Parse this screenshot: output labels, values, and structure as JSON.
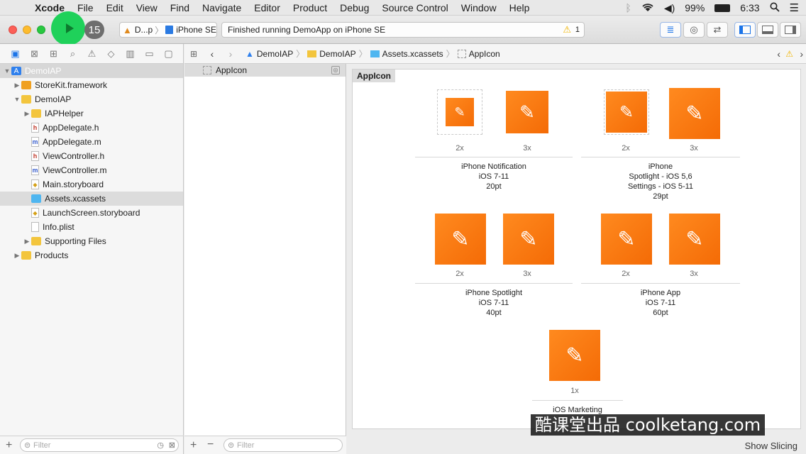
{
  "menubar": {
    "app_name": "Xcode",
    "items": [
      "File",
      "Edit",
      "View",
      "Find",
      "Navigate",
      "Editor",
      "Product",
      "Debug",
      "Source Control",
      "Window",
      "Help"
    ],
    "battery": "99%",
    "time": "6:33"
  },
  "toolbar": {
    "issue_count": "15",
    "scheme": "D...p",
    "device": "iPhone SE",
    "status": "Finished running DemoApp on iPhone SE",
    "warning_count": "1"
  },
  "navigator": {
    "tree": [
      {
        "label": "DemoIAP",
        "indent": 0,
        "icon": "project",
        "tri": "▼"
      },
      {
        "label": "StoreKit.framework",
        "indent": 1,
        "icon": "framework",
        "tri": "▶"
      },
      {
        "label": "DemoIAP",
        "indent": 1,
        "icon": "folder",
        "tri": "▼"
      },
      {
        "label": "IAPHelper",
        "indent": 2,
        "icon": "folder",
        "tri": "▶"
      },
      {
        "label": "AppDelegate.h",
        "indent": 2,
        "icon": "h",
        "tri": ""
      },
      {
        "label": "AppDelegate.m",
        "indent": 2,
        "icon": "m",
        "tri": ""
      },
      {
        "label": "ViewController.h",
        "indent": 2,
        "icon": "h",
        "tri": ""
      },
      {
        "label": "ViewController.m",
        "indent": 2,
        "icon": "m",
        "tri": ""
      },
      {
        "label": "Main.storyboard",
        "indent": 2,
        "icon": "storyboard",
        "tri": ""
      },
      {
        "label": "Assets.xcassets",
        "indent": 2,
        "icon": "assets",
        "tri": "",
        "selected": true
      },
      {
        "label": "LaunchScreen.storyboard",
        "indent": 2,
        "icon": "storyboard",
        "tri": ""
      },
      {
        "label": "Info.plist",
        "indent": 2,
        "icon": "plist",
        "tri": ""
      },
      {
        "label": "Supporting Files",
        "indent": 2,
        "icon": "folder",
        "tri": "▶"
      },
      {
        "label": "Products",
        "indent": 1,
        "icon": "folder",
        "tri": "▶"
      }
    ],
    "filter_placeholder": "Filter"
  },
  "jumpbar": {
    "crumbs": [
      "DemoIAP",
      "DemoIAP",
      "Assets.xcassets",
      "AppIcon"
    ]
  },
  "setlist": {
    "items": [
      "AppIcon"
    ],
    "filter_placeholder": "Filter"
  },
  "editor": {
    "set_title": "AppIcon",
    "groups": [
      {
        "lines": [
          "iPhone Notification",
          "iOS 7-11",
          "20pt"
        ],
        "scales": [
          "2x",
          "3x"
        ]
      },
      {
        "lines": [
          "iPhone",
          "Spotlight - iOS 5,6",
          "Settings - iOS 5-11",
          "29pt"
        ],
        "scales": [
          "2x",
          "3x"
        ]
      },
      {
        "lines": [
          "iPhone Spotlight",
          "iOS 7-11",
          "40pt"
        ],
        "scales": [
          "2x",
          "3x"
        ]
      },
      {
        "lines": [
          "iPhone App",
          "iOS 7-11",
          "60pt"
        ],
        "scales": [
          "2x",
          "3x"
        ]
      },
      {
        "lines": [
          "iOS Marketing"
        ],
        "scales": [
          "1x"
        ]
      }
    ],
    "show_slicing": "Show Slicing"
  },
  "watermark": "酷课堂出品 coolketang.com",
  "colors": {
    "accent": "#1a73e8",
    "icon_orange": "#f47a12",
    "run_green": "#1fd15a"
  }
}
